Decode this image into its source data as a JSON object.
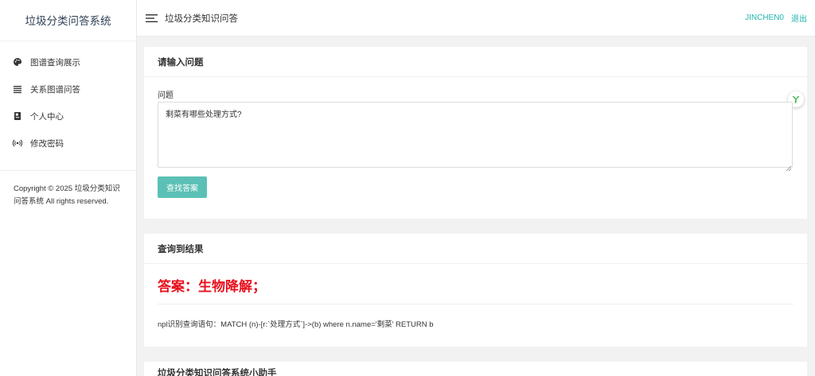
{
  "sidebar": {
    "brand": "垃圾分类问答系统",
    "items": [
      {
        "label": "图谱查询展示",
        "icon": "palette-icon"
      },
      {
        "label": "关系图谱问答",
        "icon": "list-icon"
      },
      {
        "label": "个人中心",
        "icon": "book-icon"
      },
      {
        "label": "修改密码",
        "icon": "broadcast-icon"
      }
    ],
    "copyright": "Copyright © 2025 垃圾分类知识问答系统 All rights reserved."
  },
  "topbar": {
    "title": "垃圾分类知识问答",
    "user": "JINCHEN0",
    "logout": "退出",
    "menu_icon": "hamburger-icon"
  },
  "question_card": {
    "title": "请输入问题",
    "field_label": "问题",
    "question_value": "剩菜有哪些处理方式?",
    "button_label": "查找答案",
    "badge_icon": "y-logo-icon"
  },
  "result_card": {
    "title": "查询到结果",
    "answer": "答案：生物降解；",
    "query": "npl识别查询语句：MATCH (n)-[r:`处理方式`]->(b) where n.name='剩菜' RETURN b"
  },
  "helper_card": {
    "title": "垃圾分类知识问答系统小助手"
  },
  "colors": {
    "accent": "#1fb5ac",
    "button": "#5bc0b5",
    "answer": "#e8101c",
    "background": "#f2f2f2"
  }
}
